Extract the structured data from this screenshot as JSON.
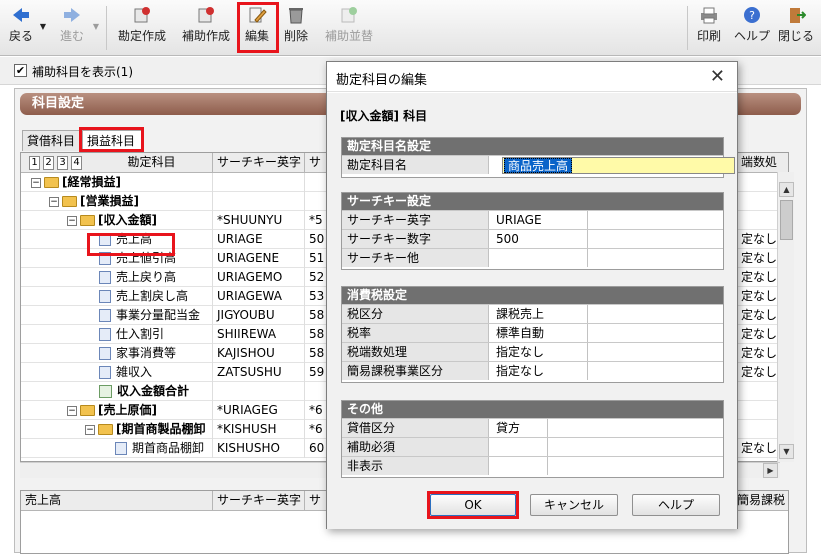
{
  "toolbar": {
    "back": "戻る",
    "forward": "進む",
    "create_account": "勘定作成",
    "create_sub": "補助作成",
    "edit": "編集",
    "delete": "削除",
    "sub_replace": "補助並替",
    "print": "印刷",
    "help": "ヘルプ",
    "close": "閉じる"
  },
  "options": {
    "show_sub": "補助科目を表示(1)"
  },
  "panel": {
    "title": "科目設定"
  },
  "tabs": [
    {
      "label": "貸借科目"
    },
    {
      "label": "損益科目"
    }
  ],
  "grid": {
    "levels": [
      "1",
      "2",
      "3",
      "4"
    ],
    "headers": {
      "name": "勘定科目",
      "search_alpha": "サーチキー英字",
      "search_num": "サ",
      "rounding": "端数処"
    },
    "rows": [
      {
        "name": "[経常損益]",
        "alpha": "",
        "num": "",
        "rounding": ""
      },
      {
        "name": "[営業損益]",
        "alpha": "",
        "num": "",
        "rounding": ""
      },
      {
        "name": "[収入金額]",
        "alpha": "*SHUUNYU",
        "num": "*5",
        "rounding": ""
      },
      {
        "name": "売上高",
        "alpha": "URIAGE",
        "num": "50",
        "rounding": "定なし"
      },
      {
        "name": "売上値引高",
        "alpha": "URIAGENE",
        "num": "51",
        "rounding": "定なし"
      },
      {
        "name": "売上戻り高",
        "alpha": "URIAGEMO",
        "num": "52",
        "rounding": "定なし"
      },
      {
        "name": "売上割戻し高",
        "alpha": "URIAGEWA",
        "num": "53",
        "rounding": "定なし"
      },
      {
        "name": "事業分量配当金",
        "alpha": "JIGYOUBU",
        "num": "58",
        "rounding": "定なし"
      },
      {
        "name": "仕入割引",
        "alpha": "SHIIREWA",
        "num": "58",
        "rounding": "定なし"
      },
      {
        "name": "家事消費等",
        "alpha": "KAJISHOU",
        "num": "58",
        "rounding": "定なし"
      },
      {
        "name": "雑収入",
        "alpha": "ZATSUSHU",
        "num": "59",
        "rounding": "定なし"
      },
      {
        "name": "収入金額合計",
        "alpha": "",
        "num": "",
        "rounding": ""
      },
      {
        "name": "[売上原価]",
        "alpha": "*URIAGEG",
        "num": "*6",
        "rounding": ""
      },
      {
        "name": "[期首商製品棚卸",
        "alpha": "*KISHUSH",
        "num": "*6",
        "rounding": ""
      },
      {
        "name": "期首商品棚卸",
        "alpha": "KISHUSHO",
        "num": "60",
        "rounding": "定なし"
      }
    ]
  },
  "bottom": {
    "name": "売上高",
    "alpha": "サーチキー英字",
    "num": "サ",
    "tax": "簡易課税"
  },
  "dialog": {
    "title": "勘定科目の編集",
    "subtitle": "[収入金額] 科目",
    "name_group": {
      "title": "勘定科目名設定",
      "label": "勘定科目名",
      "value": "商品売上高"
    },
    "search_group": {
      "title": "サーチキー設定",
      "rows": [
        {
          "label": "サーチキー英字",
          "value": "URIAGE"
        },
        {
          "label": "サーチキー数字",
          "value": "500"
        },
        {
          "label": "サーチキー他",
          "value": ""
        }
      ]
    },
    "tax_group": {
      "title": "消費税設定",
      "rows": [
        {
          "label": "税区分",
          "value": "課税売上"
        },
        {
          "label": "税率",
          "value": "標準自動"
        },
        {
          "label": "税端数処理",
          "value": "指定なし"
        },
        {
          "label": "簡易課税事業区分",
          "value": "指定なし"
        }
      ]
    },
    "other_group": {
      "title": "その他",
      "rows": [
        {
          "label": "貸借区分",
          "value": "貸方"
        },
        {
          "label": "補助必須",
          "value": ""
        },
        {
          "label": "非表示",
          "value": ""
        }
      ]
    },
    "ok": "OK",
    "cancel": "キャンセル",
    "help": "ヘルプ",
    "close_glyph": "✕"
  }
}
